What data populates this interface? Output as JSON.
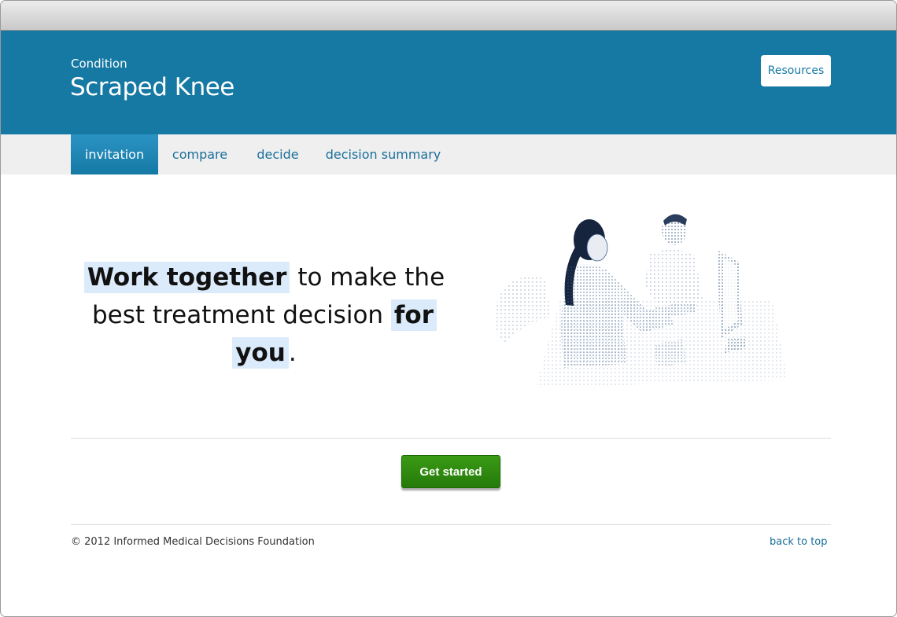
{
  "header": {
    "label": "Condition",
    "title": "Scraped Knee",
    "resources_label": "Resources"
  },
  "nav": {
    "tabs": [
      {
        "label": "invitation",
        "active": true
      },
      {
        "label": "compare",
        "active": false
      },
      {
        "label": "decide",
        "active": false
      },
      {
        "label": "decision summary",
        "active": false
      }
    ]
  },
  "hero": {
    "part1": "Work together",
    "part2": " to make the best treatment decision ",
    "part3": "for",
    "part4": "you",
    "part5": "."
  },
  "actions": {
    "get_started_label": "Get started"
  },
  "footer": {
    "copyright": "© 2012 Informed Medical Decisions Foundation",
    "back_to_top": "back to top"
  },
  "colors": {
    "header_bg": "#1579a4",
    "nav_bg": "#efefef",
    "accent_green": "#257a0b",
    "highlight": "#dcebfb"
  }
}
